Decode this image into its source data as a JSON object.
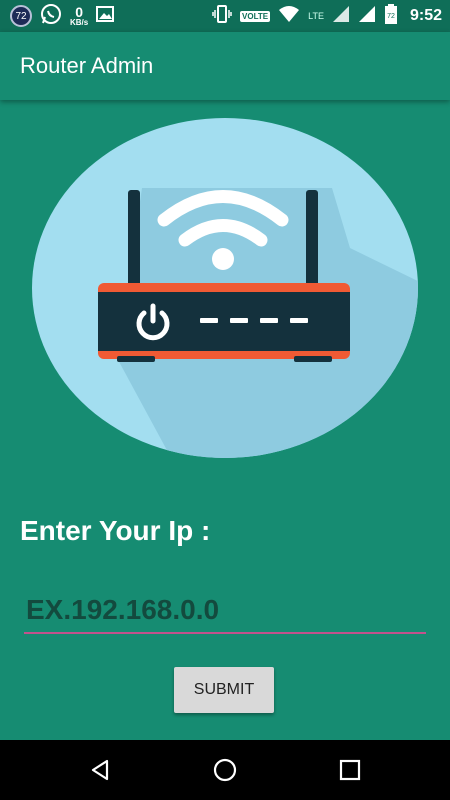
{
  "status_bar": {
    "notification_badge": "72",
    "net_speed_value": "0",
    "net_speed_unit": "KB/s",
    "volte_label": "VOLTE",
    "lte_label": "LTE",
    "battery_level": "72",
    "time": "9:52"
  },
  "app_bar": {
    "title": "Router Admin"
  },
  "form": {
    "ip_label": "Enter Your Ip :",
    "ip_placeholder": "EX.192.168.0.0",
    "ip_value": "",
    "submit_label": "SUBMIT"
  },
  "colors": {
    "background": "#168c72",
    "status_bar": "#0f6e58",
    "input_underline": "#c2528d",
    "circle": "#a3def0",
    "router_body": "#14313d",
    "router_accent": "#f05a34"
  },
  "icons": [
    "whatsapp-icon",
    "image-icon",
    "vibrate-icon",
    "wifi-icon",
    "signal-icon",
    "battery-icon",
    "router-illustration",
    "back-icon",
    "home-icon",
    "recents-icon"
  ]
}
